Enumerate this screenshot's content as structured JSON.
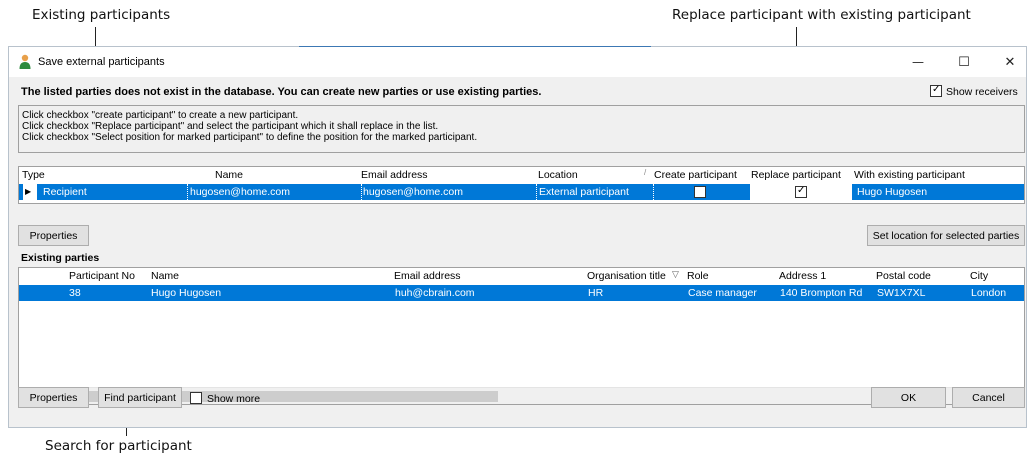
{
  "annotations": {
    "existing_participants": "Existing participants",
    "replace_participant": "Replace participant with existing participant",
    "search_participant": "Search for participant"
  },
  "window": {
    "title": "Save external participants",
    "minimize": "—",
    "maximize": "☐",
    "close": "✕"
  },
  "headline": "The listed parties does not exist in the database. You can create new parties or use existing parties.",
  "show_receivers": {
    "label": "Show receivers",
    "checked": true
  },
  "instructions": [
    "Click checkbox \"create participant\" to create a new participant.",
    "Click checkbox \"Replace participant\" and select the participant which it shall replace in the list.",
    "Click checkbox \"Select position for marked participant\" to define the position for the marked participant."
  ],
  "participants_grid": {
    "columns": [
      "Type",
      "Name",
      "Email address",
      "Location",
      "Create participant",
      "Replace participant",
      "With existing participant"
    ],
    "rows": [
      {
        "type": "Recipient",
        "name": "hugosen@home.com",
        "email": "hugosen@home.com",
        "location": "External participant",
        "create": false,
        "replace": true,
        "existing": "Hugo Hugosen"
      }
    ]
  },
  "buttons": {
    "properties_top": "Properties",
    "set_location": "Set location for selected parties",
    "properties_bottom": "Properties",
    "find_participant": "Find participant",
    "ok": "OK",
    "cancel": "Cancel"
  },
  "existing_parties": {
    "label": "Existing parties",
    "columns": [
      "Participant No",
      "Name",
      "Email address",
      "Organisation title",
      "Role",
      "Address 1",
      "Postal code",
      "City"
    ],
    "rows": [
      {
        "no": "38",
        "name": "Hugo Hugosen",
        "email": "huh@cbrain.com",
        "org_title": "HR",
        "role": "Case manager",
        "address": "140 Brompton Rd",
        "postal": "SW1X7XL",
        "city": "London"
      }
    ]
  },
  "show_more": {
    "label": "Show more",
    "checked": false
  },
  "colors": {
    "selection": "#0078d7",
    "dialog_bg": "#f0f0f0",
    "button_bg": "#e1e1e1"
  }
}
